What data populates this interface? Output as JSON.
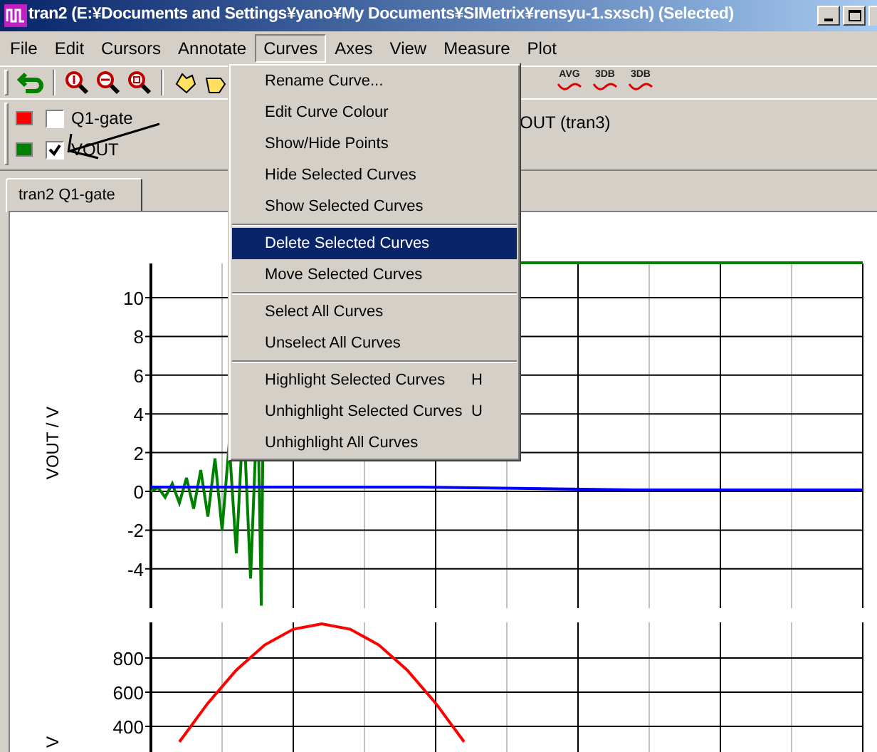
{
  "window": {
    "title": "tran2 (E:¥Documents and Settings¥yano¥My Documents¥SIMetrix¥rensyu-1.sxsch) (Selected)"
  },
  "menu_bar": [
    {
      "label": "File",
      "selected": false
    },
    {
      "label": "Edit",
      "selected": false
    },
    {
      "label": "Cursors",
      "selected": false
    },
    {
      "label": "Annotate",
      "selected": false
    },
    {
      "label": "Curves",
      "selected": true
    },
    {
      "label": "Axes",
      "selected": false
    },
    {
      "label": "View",
      "selected": false
    },
    {
      "label": "Measure",
      "selected": false
    },
    {
      "label": "Plot",
      "selected": false
    }
  ],
  "toolbar_labels": [
    "AVG",
    "3DB",
    "3DB"
  ],
  "legend": [
    {
      "label": "Q1-gate",
      "color": "#ff0000",
      "checked": false
    },
    {
      "label": "VOUT",
      "color": "#008000",
      "checked": true
    }
  ],
  "legend_other": "OUT (tran3)",
  "tabs": [
    {
      "label": "tran2 Q1-gate",
      "selected": true
    }
  ],
  "plot": {
    "panels": [
      {
        "axis_title": "VOUT / V",
        "tick_labels": [
          "10",
          "8",
          "6",
          "4",
          "2",
          "0",
          "-2",
          "-4"
        ]
      },
      {
        "axis_title": "V",
        "tick_labels": [
          "800",
          "600",
          "400"
        ]
      }
    ]
  },
  "dropdown_menu": {
    "items": [
      {
        "kind": "item",
        "label": "Rename Curve...",
        "selected": false
      },
      {
        "kind": "item",
        "label": "Edit Curve Colour",
        "selected": false
      },
      {
        "kind": "item",
        "label": "Show/Hide Points",
        "selected": false
      },
      {
        "kind": "item",
        "label": "Hide Selected Curves",
        "selected": false
      },
      {
        "kind": "item",
        "label": "Show Selected Curves",
        "selected": false
      },
      {
        "kind": "separator"
      },
      {
        "kind": "item",
        "label": "Delete Selected Curves",
        "selected": true
      },
      {
        "kind": "item",
        "label": "Move Selected Curves",
        "selected": false
      },
      {
        "kind": "separator"
      },
      {
        "kind": "item",
        "label": "Select All Curves",
        "selected": false
      },
      {
        "kind": "item",
        "label": "Unselect All Curves",
        "selected": false
      },
      {
        "kind": "separator"
      },
      {
        "kind": "item",
        "label": "Highlight Selected Curves",
        "shortcut": "H",
        "selected": false
      },
      {
        "kind": "item",
        "label": "Unhighlight Selected Curves",
        "shortcut": "U",
        "selected": false
      },
      {
        "kind": "item",
        "label": "Unhighlight All Curves",
        "selected": false
      }
    ]
  }
}
